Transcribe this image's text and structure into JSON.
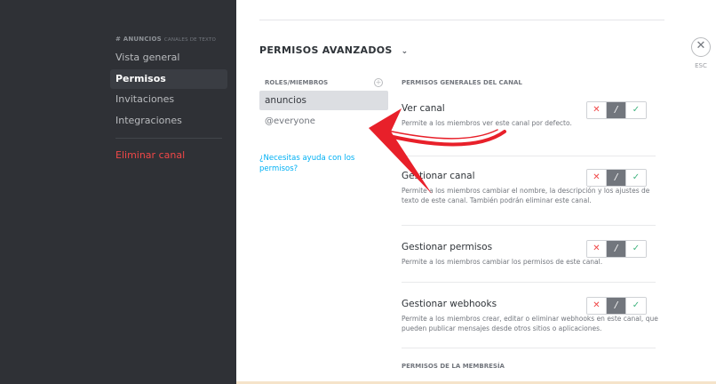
{
  "sidebar": {
    "channel": "# ANUNCIOS",
    "subtitle": "CANALES DE TEXTO",
    "items": [
      "Vista general",
      "Permisos",
      "Invitaciones",
      "Integraciones"
    ],
    "delete_label": "Eliminar canal"
  },
  "main": {
    "heading": "PERMISOS AVANZADOS",
    "chevron": "⌄",
    "roles_header": "ROLES/MIEMBROS",
    "roles": [
      "anuncios",
      "@everyone"
    ],
    "help_link": "¿Necesitas ayuda con los permisos?",
    "perms_header": "PERMISOS GENERALES DEL CANAL",
    "permissions": [
      {
        "title": "Ver canal",
        "desc": "Permite a los miembros ver este canal por defecto."
      },
      {
        "title": "Gestionar canal",
        "desc": "Permite a los miembros cambiar el nombre, la descripción y los ajustes de texto de este canal. También podrán eliminar este canal."
      },
      {
        "title": "Gestionar permisos",
        "desc": "Permite a los miembros cambiar los permisos de este canal."
      },
      {
        "title": "Gestionar webhooks",
        "desc": "Permite a los miembros crear, editar o eliminar webhooks en este canal, que pueden publicar mensajes desde otros sitios o aplicaciones."
      }
    ],
    "section2_header": "PERMISOS DE LA MEMBRESÍA"
  },
  "toggle": {
    "deny": "✕",
    "neutral": "/",
    "allow": "✓"
  },
  "close": {
    "icon": "✕",
    "esc_label": "ESC"
  },
  "colors": {
    "sidebar_bg": "#2f3136",
    "danger": "#f04747",
    "link": "#00b0f4",
    "allow": "#43b581",
    "arrow": "#e8202a"
  }
}
